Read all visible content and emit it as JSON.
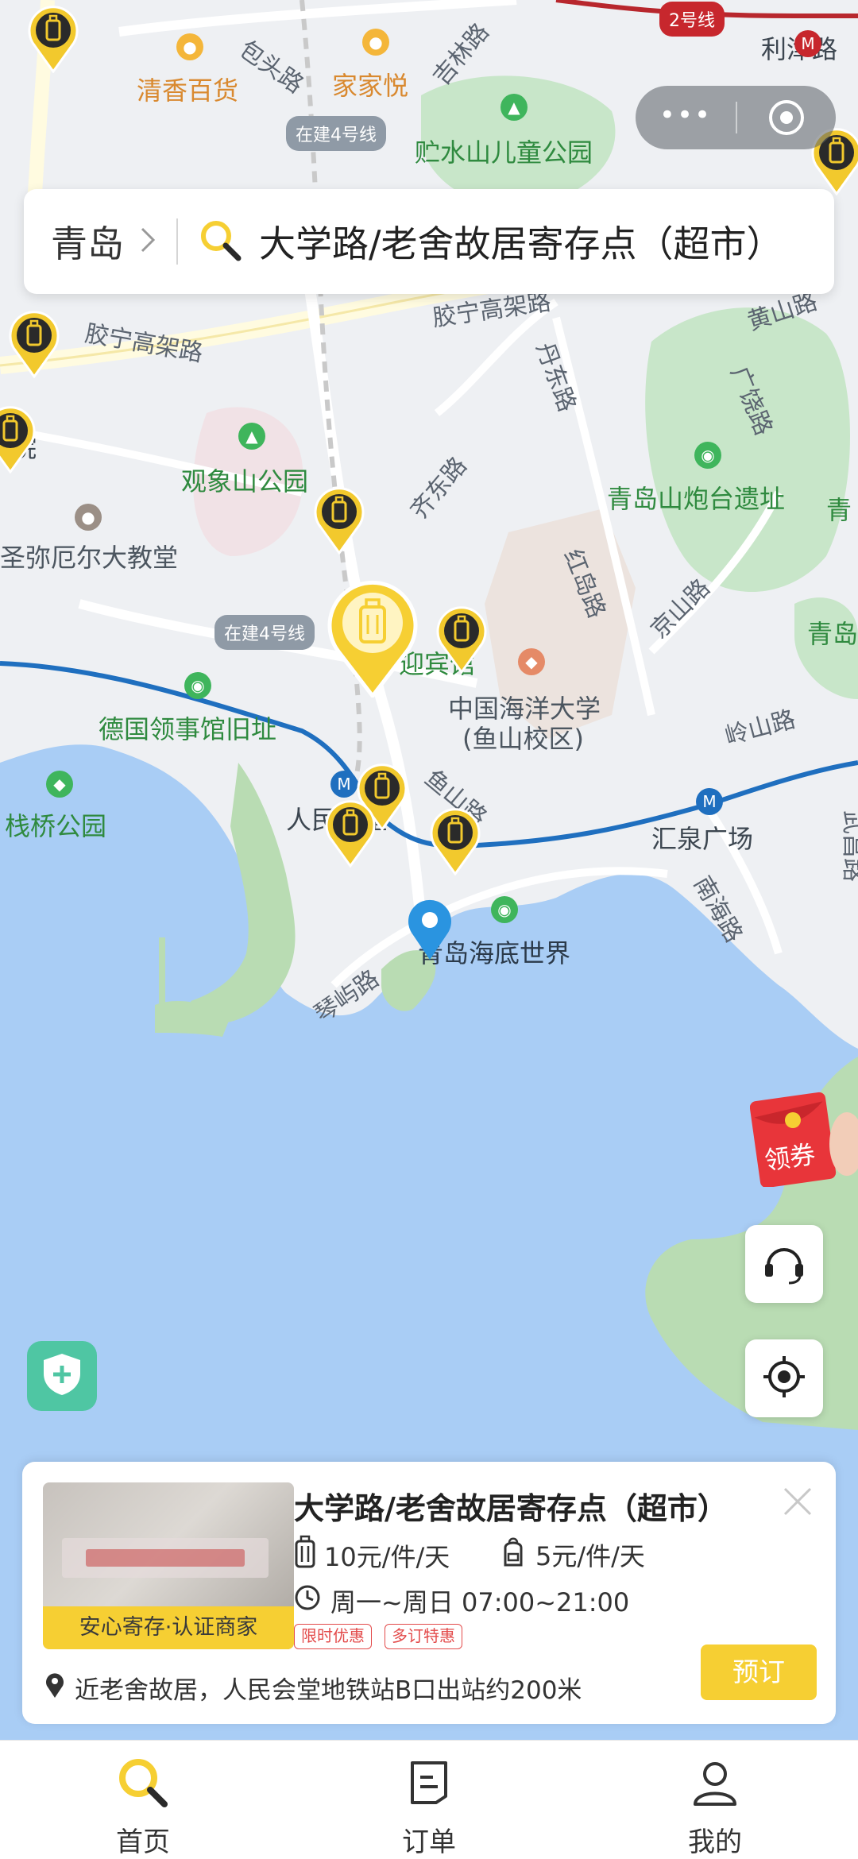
{
  "top": {
    "capsule": {
      "more_label": "•••",
      "more_icon": "more-dots-icon",
      "close_icon": "target-close-icon"
    },
    "search": {
      "city": "青岛",
      "query": "大学路/老舍故居寄存点（超市）"
    }
  },
  "map": {
    "labels": {
      "qingxiang": "清香百货",
      "jiajiayue": "家家悦",
      "zhushuishan": "贮水山儿童公园",
      "guanxiangshan": "观象山公园",
      "shengmiaeer": "圣弥厄尔大教堂",
      "deguo": "德国领事馆旧址",
      "zhanqiao": "栈桥公园",
      "renmin": "人民会堂",
      "yingbin": "迎宾馆",
      "ocean_univ_1": "中国海洋大学",
      "ocean_univ_2": "(鱼山校区)",
      "huiquan": "汇泉广场",
      "haidi": "青岛海底世界",
      "paotai": "青岛山炮台遗址",
      "qing_right": "青岛",
      "qing_top_right": "青",
      "yuan": "院",
      "lijinlu": "利津路",
      "baotou": "包头路",
      "jilin": "吉林路",
      "jiaoning": "胶宁高架路",
      "jiaoning2": "胶宁高架路",
      "huangshan": "黄山路",
      "guangrao": "广饶路",
      "dandong": "丹东路",
      "qidong": "齐东路",
      "hongdao": "红岛路",
      "jingshan": "京山路",
      "zuoshan": "岭山路",
      "yushan": "鱼山路",
      "nanhai": "南海路",
      "qinyu": "琴屿路",
      "wuchang": "武昌路",
      "line2": "2号线",
      "under_construction_1": "在建4号线",
      "under_construction_2": "在建4号线"
    }
  },
  "floats": {
    "coupon_label": "领券",
    "service_icon": "headset-icon",
    "locate_icon": "locate-icon",
    "shield_icon": "shield-plus-icon"
  },
  "card": {
    "title": "大学路/老舍故居寄存点（超市）",
    "badge": "安心寄存·认证商家",
    "price_luggage": "10元/件/天",
    "price_bag": "5元/件/天",
    "hours": "周一~周日 07:00~21:00",
    "tags": [
      "限时优惠",
      "多订特惠"
    ],
    "address": "近老舍故居，人民会堂地铁站B口出站约200米",
    "book_label": "预订"
  },
  "tabs": [
    {
      "label": "首页",
      "icon": "search-icon",
      "active": true
    },
    {
      "label": "订单",
      "icon": "order-icon",
      "active": false
    },
    {
      "label": "我的",
      "icon": "profile-icon",
      "active": false
    }
  ],
  "colors": {
    "accent_yellow": "#f6cf33",
    "sea_blue": "#a9cdf5",
    "land_gray": "#eef0f3",
    "park_green": "#c8e6c9",
    "metro_blue": "#1f6fbf",
    "tag_red": "#e34b4b"
  }
}
